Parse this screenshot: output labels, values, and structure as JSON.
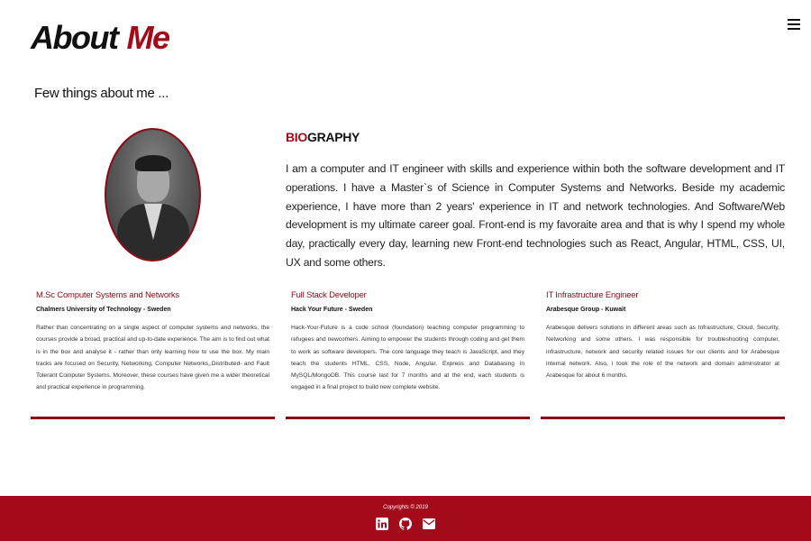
{
  "header": {
    "title_part1": "About",
    "title_part2": "Me"
  },
  "subtitle": "Few things about me ...",
  "biography": {
    "heading_accent": "BIO",
    "heading_rest": "GRAPHY",
    "text": "I am a computer and IT engineer with skills and experience within both the software development and IT operations. I have a Master`s of Science in Computer Systems and Networks. Beside my academic experience, I have more than 2 years' experience in IT and network technologies. And Software/Web development is my ultimate career goal. Front-end is my favoraite area and that is why I spend my whole day, practically every day, learning new Front-end technologies such as React, Angular, HTML, CSS, UI, UX and some others."
  },
  "cards": [
    {
      "title": "M.Sc Computer Systems and Networks",
      "org": "Chalmers University of Technology - Sweden",
      "text": "Rather than concentrating on a single aspect of computer systems and networks, the courses provide a broad, practical and up-to-date experience. The aim is to find out what is in the box and analyse it - rather than only learning how to use the box. My main tracks are focused on Security, Networking, Computer Networks,,Distributed- and Fault Tolerant Computer Systems. Moreover, these courses have given me a wider theoretical and practical experience in programming."
    },
    {
      "title": "Full Stack Developer",
      "org": "Hack Your Future - Sweden",
      "text": "Hack-Your-Future is a code school (foundation) teaching computer programming to refugees and newcomers. Aiming to empower the students through coding and get them to work as software developers. The core language they teach is JavaScript, and they teach the students HTML, CSS, Node, Angular, Express and Databasing in MySQL/MongoDB. This course last for 7 months and at the end, each students is engaged in a final project to build new complete website."
    },
    {
      "title": "IT Infrastructure Engineer",
      "org": "Arabesque Group - Kuwait",
      "text": "Arabesque delivers solutions in different areas such as Infrastructure, Cloud, Security, Networking and some others. I was responsible for troubleshooting computer, infrastructure, network and security related issues for our clients and for Arabesque internal network. Also, i took the role of the network and domain adminstrator at Arabesque for about 6 months."
    }
  ],
  "footer": {
    "copyright": "Copyrights © 2019",
    "icons": [
      "linkedin-icon",
      "github-icon",
      "email-icon"
    ]
  },
  "colors": {
    "accent": "#a30b1a",
    "card_border": "#8b0a14"
  }
}
